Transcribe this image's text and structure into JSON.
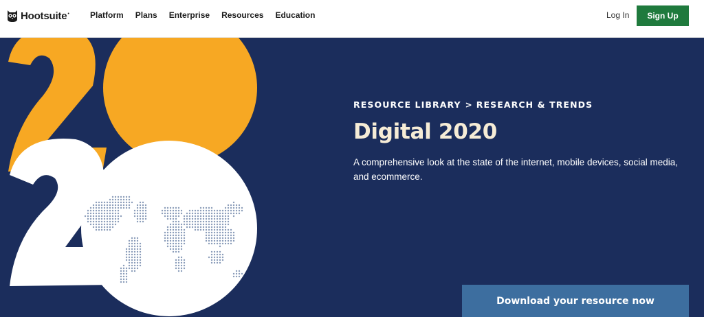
{
  "brand": {
    "name": "Hootsuite",
    "trademark": "•"
  },
  "nav": {
    "items": [
      {
        "label": "Platform"
      },
      {
        "label": "Plans"
      },
      {
        "label": "Enterprise"
      },
      {
        "label": "Resources"
      },
      {
        "label": "Education"
      }
    ],
    "login_label": "Log In",
    "signup_label": "Sign Up"
  },
  "hero": {
    "breadcrumb": [
      {
        "label": "RESOURCE LIBRARY"
      },
      {
        "label": "RESEARCH & TRENDS"
      }
    ],
    "breadcrumb_separator": ">",
    "title": "Digital 2020",
    "description": "A comprehensive look at the state of the internet, mobile devices, social media, and ecommerce.",
    "download_label": "Download your resource now",
    "artwork": {
      "icon": "digital-2020-world-map-artwork",
      "digits": "2020"
    }
  },
  "colors": {
    "hero_background": "#1b2d5c",
    "accent_yellow": "#f7a823",
    "title_cream": "#f6ecd6",
    "signup_green": "#1f7a3d",
    "download_blue": "#3d6e9f"
  }
}
